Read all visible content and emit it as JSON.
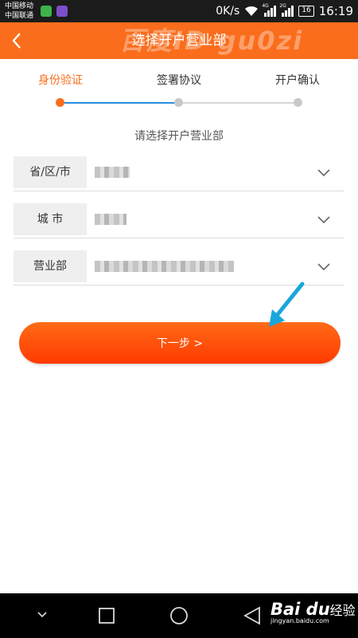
{
  "status_bar": {
    "carrier_1": "中国移动",
    "carrier_2": "中国联通",
    "net_speed": "0K/s",
    "sig1_label": "4G",
    "sig2_label": "2G",
    "battery": "16",
    "time": "16:19"
  },
  "app_bar": {
    "back_symbol": "<",
    "title": "选择开户营业部",
    "watermark": "百度ID gu0zi"
  },
  "steps": [
    {
      "label": "身份验证",
      "active": true
    },
    {
      "label": "签署协议",
      "active": false
    },
    {
      "label": "开户确认",
      "active": false
    }
  ],
  "prompt": "请选择开户营业部",
  "form": {
    "province_label": "省/区/市",
    "city_label": "城 市",
    "branch_label": "营业部"
  },
  "next_button": "下一步 >",
  "watermark_footer": {
    "brand": "Bai du",
    "jingyan": "经验",
    "url": "jingyan.baidu.com"
  },
  "colors": {
    "accent": "#fa6d1c",
    "progress": "#2a8de0",
    "arrow": "#19a6dc"
  },
  "icons": [
    "back-icon",
    "chevron-down-icon",
    "wifi-icon",
    "nav-back-icon",
    "nav-home-icon",
    "nav-recent-icon",
    "nav-menu-icon"
  ]
}
